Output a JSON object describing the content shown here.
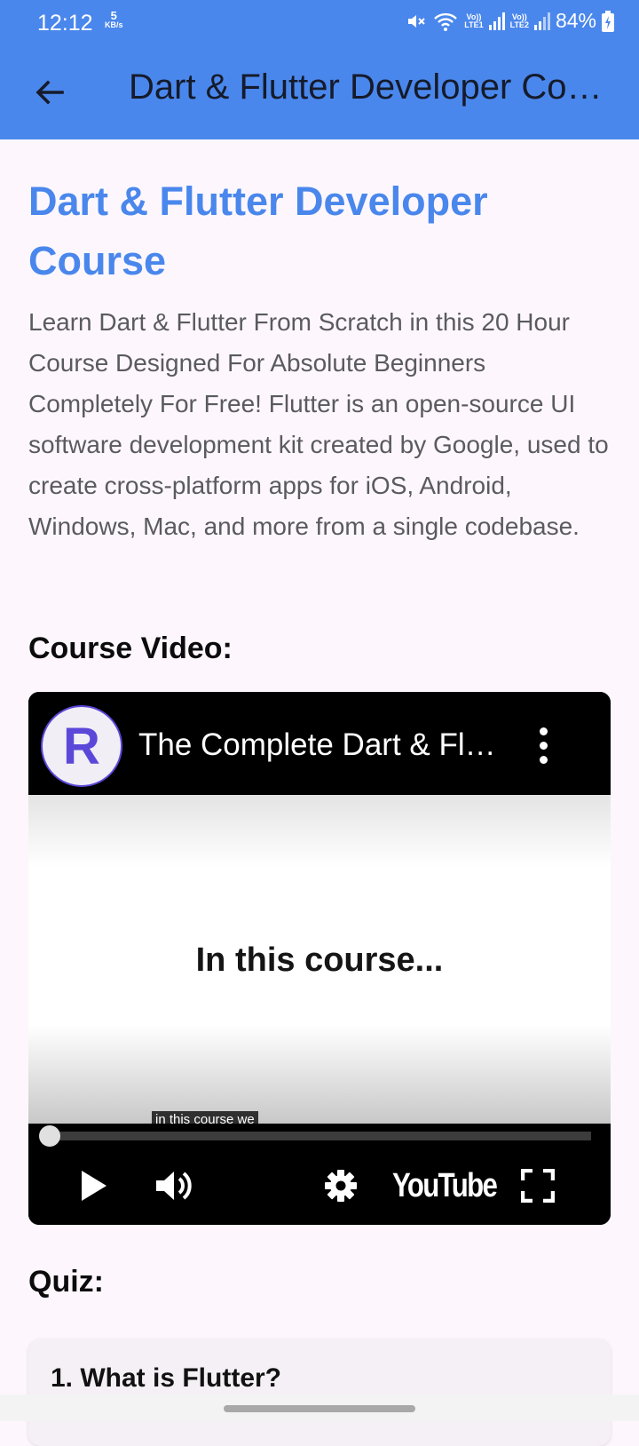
{
  "status_bar": {
    "time": "12:12",
    "net_speed_value": "5",
    "net_speed_unit": "KB/s",
    "sim1_label_top": "Vo))",
    "sim1_label_bottom": "LTE1",
    "sim2_label_top": "Vo))",
    "sim2_label_bottom": "LTE2",
    "battery": "84%"
  },
  "app_bar": {
    "title": "Dart & Flutter Developer Course",
    "back_icon": "arrow-left-icon",
    "color": "#4a87ec"
  },
  "course": {
    "title": "Dart & Flutter Developer Course",
    "description": "Learn Dart & Flutter From Scratch in this 20 Hour Course Designed For Absolute Beginners  Completely For Free! Flutter is an open-source UI software development kit created by Google, used to create cross-platform apps for iOS, Android, Windows, Mac, and more from a single codebase."
  },
  "video_section": {
    "label": "Course Video:",
    "channel_initial": "R",
    "video_title": "The Complete Dart & Flutter Developer Course",
    "frame_text": "In this course...",
    "caption": "in this course we",
    "progress": 0.0,
    "youtube_label": "YouTube"
  },
  "quiz_section": {
    "label": "Quiz:",
    "questions": [
      {
        "text": "1. What is Flutter?"
      }
    ]
  }
}
